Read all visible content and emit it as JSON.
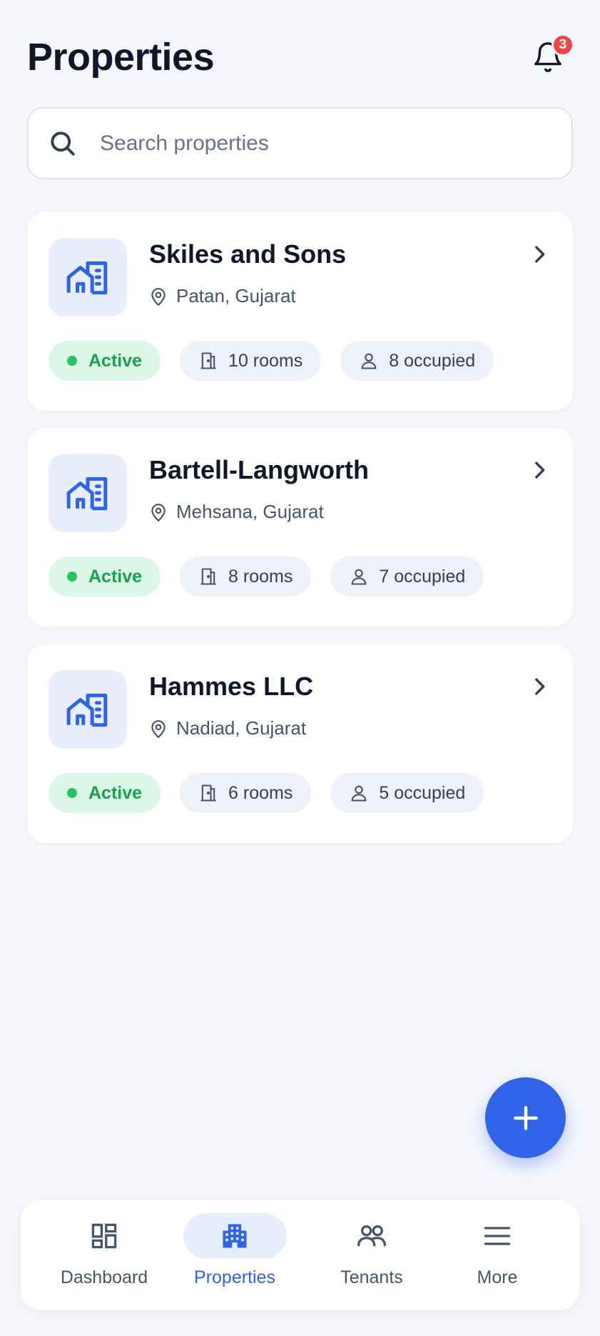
{
  "header": {
    "title": "Properties",
    "notification_count": "3"
  },
  "search": {
    "placeholder": "Search properties",
    "value": ""
  },
  "properties": [
    {
      "name": "Skiles and Sons",
      "location": "Patan, Gujarat",
      "status": "Active",
      "rooms": "10 rooms",
      "occupied": "8 occupied"
    },
    {
      "name": "Bartell-Langworth",
      "location": "Mehsana, Gujarat",
      "status": "Active",
      "rooms": "8 rooms",
      "occupied": "7 occupied"
    },
    {
      "name": "Hammes LLC",
      "location": "Nadiad, Gujarat",
      "status": "Active",
      "rooms": "6 rooms",
      "occupied": "5 occupied"
    }
  ],
  "nav": {
    "items": [
      {
        "label": "Dashboard",
        "icon": "dashboard-icon"
      },
      {
        "label": "Properties",
        "icon": "building-icon"
      },
      {
        "label": "Tenants",
        "icon": "users-icon"
      },
      {
        "label": "More",
        "icon": "menu-icon"
      }
    ],
    "selected": "Properties"
  },
  "colors": {
    "accent": "#2f63e8",
    "active_bg": "#dcf7e8",
    "active_text": "#16a34a",
    "badge": "#ef4444",
    "background": "#f5f7fc"
  }
}
